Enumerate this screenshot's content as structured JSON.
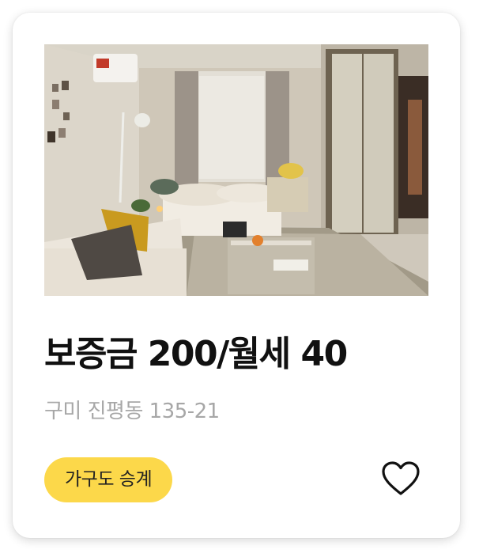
{
  "listing": {
    "price": "보증금 200/월세 40",
    "address": "구미 진평동 135-21",
    "tag": "가구도 승계",
    "tag_color": "#fcd84a",
    "favorite_icon": "heart-outline-icon"
  },
  "photo": {
    "subject": "room-interior-photo"
  }
}
